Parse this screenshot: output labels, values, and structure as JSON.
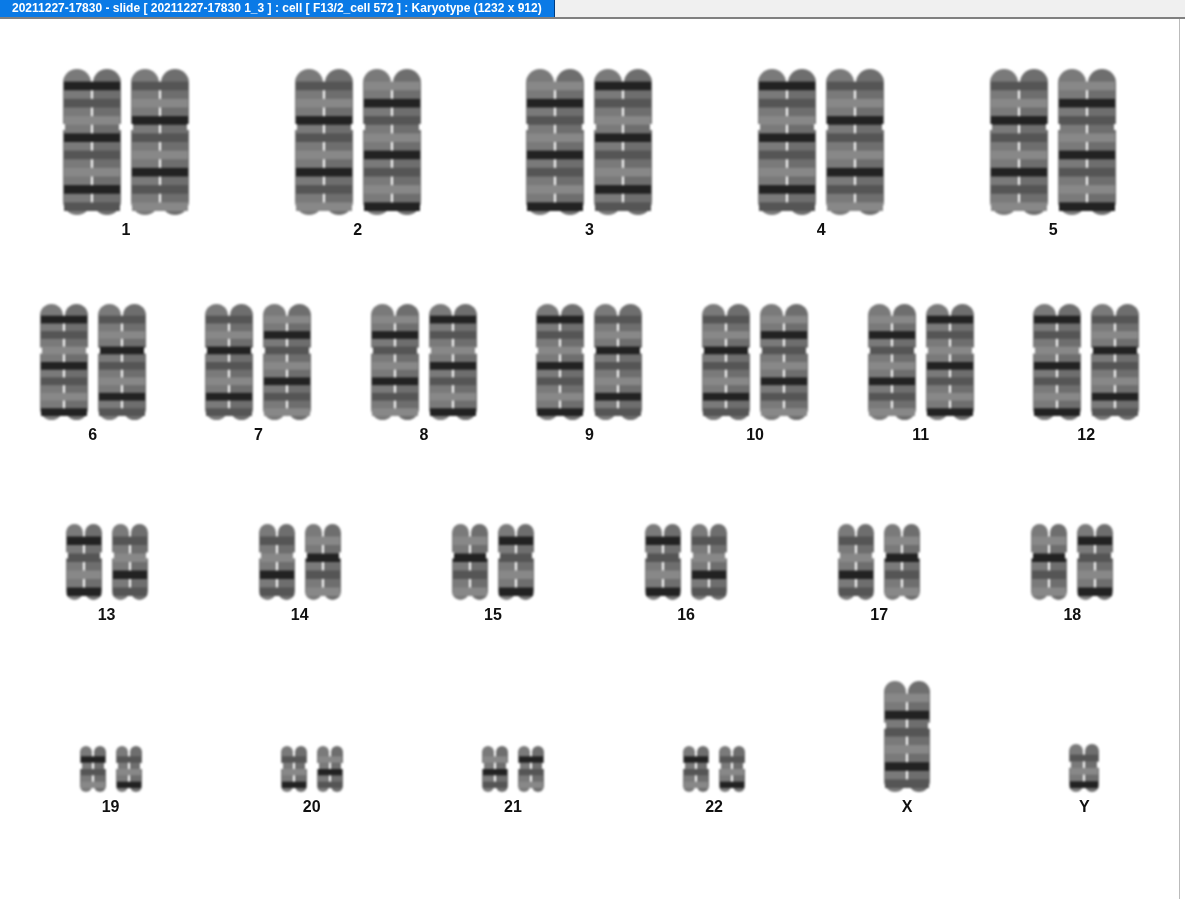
{
  "window": {
    "title": "20211227-17830 - slide [ 20211227-17830 1_3 ] : cell [ F13/2_cell 572 ] : Karyotype  (1232 x 912)"
  },
  "karyotype": {
    "rows": [
      {
        "groups": [
          {
            "label": "1",
            "kind": "pair"
          },
          {
            "label": "2",
            "kind": "pair"
          },
          {
            "label": "3",
            "kind": "pair"
          },
          {
            "label": "4",
            "kind": "pair"
          },
          {
            "label": "5",
            "kind": "pair"
          }
        ]
      },
      {
        "groups": [
          {
            "label": "6",
            "kind": "pair"
          },
          {
            "label": "7",
            "kind": "pair"
          },
          {
            "label": "8",
            "kind": "pair"
          },
          {
            "label": "9",
            "kind": "pair"
          },
          {
            "label": "10",
            "kind": "pair"
          },
          {
            "label": "11",
            "kind": "pair"
          },
          {
            "label": "12",
            "kind": "pair"
          }
        ]
      },
      {
        "groups": [
          {
            "label": "13",
            "kind": "pair"
          },
          {
            "label": "14",
            "kind": "pair"
          },
          {
            "label": "15",
            "kind": "pair"
          },
          {
            "label": "16",
            "kind": "pair"
          },
          {
            "label": "17",
            "kind": "pair"
          },
          {
            "label": "18",
            "kind": "pair"
          }
        ]
      },
      {
        "groups": [
          {
            "label": "19",
            "kind": "pair"
          },
          {
            "label": "20",
            "kind": "pair"
          },
          {
            "label": "21",
            "kind": "pair"
          },
          {
            "label": "22",
            "kind": "pair"
          },
          {
            "label": "X",
            "kind": "single-long"
          },
          {
            "label": "Y",
            "kind": "single-short"
          }
        ]
      }
    ]
  }
}
